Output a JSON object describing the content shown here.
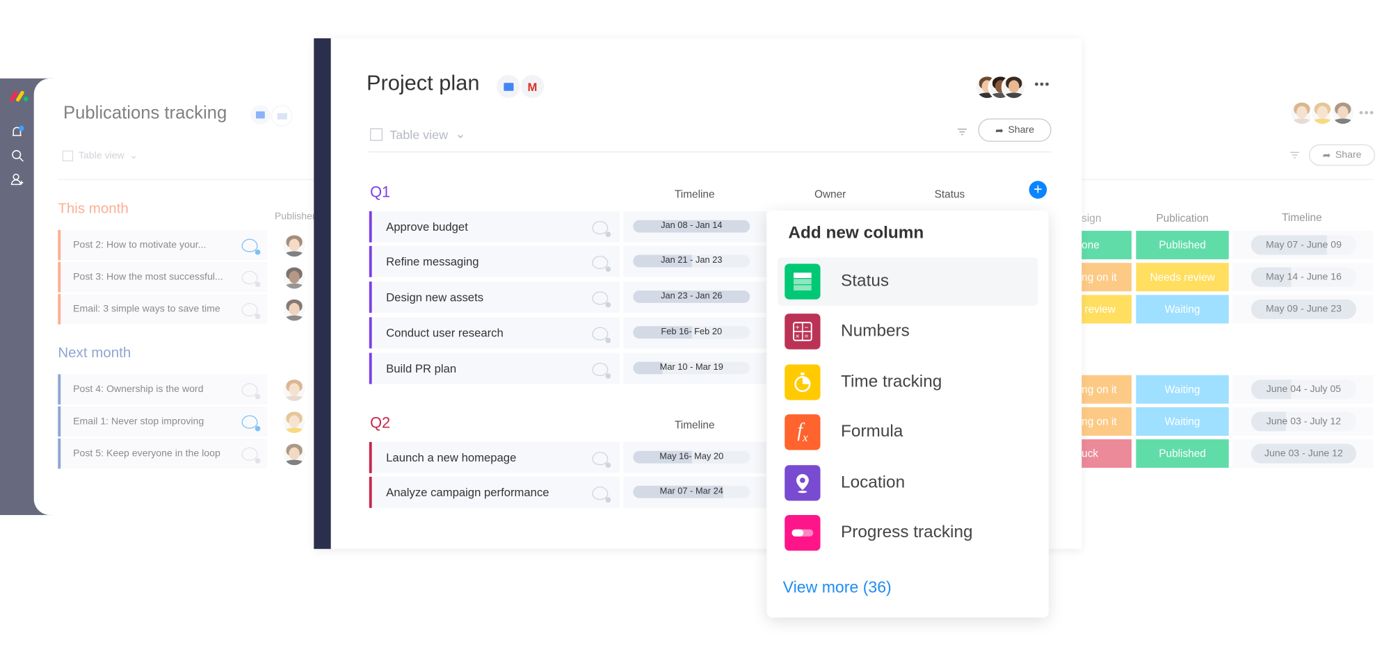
{
  "left_board": {
    "title": "Publications tracking",
    "view": "Table view",
    "publisher_header": "Publisher",
    "groups": [
      {
        "name": "This month",
        "color": "#fb7d4f",
        "items": [
          {
            "name": "Post 2: How to motivate your...",
            "comment_active": true
          },
          {
            "name": "Post 3: How the most successful...",
            "comment_active": false
          },
          {
            "name": "Email: 3 simple ways to save time",
            "comment_active": false
          }
        ]
      },
      {
        "name": "Next month",
        "color": "#4a6fb5",
        "items": [
          {
            "name": "Post 4: Ownership is the word",
            "comment_active": false
          },
          {
            "name": "Email 1: Never stop improving",
            "comment_active": true
          },
          {
            "name": "Post 5: Keep everyone in the loop",
            "comment_active": false
          }
        ]
      }
    ]
  },
  "center_board": {
    "title": "Project plan",
    "view": "Table view",
    "share_label": "Share",
    "columns": {
      "timeline": "Timeline",
      "owner": "Owner",
      "status": "Status"
    },
    "groups": [
      {
        "name": "Q1",
        "color": "#7b3fe4",
        "items": [
          {
            "name": "Approve budget",
            "timeline": "Jan 08 - Jan 14",
            "progress": 1.0
          },
          {
            "name": "Refine messaging",
            "timeline": "Jan 21 - Jan 23",
            "progress": 0.5
          },
          {
            "name": "Design new assets",
            "timeline": "Jan 23 - Jan 26",
            "progress": 1.0
          },
          {
            "name": "Conduct user research",
            "timeline": "Feb 16- Feb 20",
            "progress": 0.5
          },
          {
            "name": "Build PR plan",
            "timeline": "Mar 10 - Mar 19",
            "progress": 0.25
          }
        ]
      },
      {
        "name": "Q2",
        "color": "#c8254a",
        "items": [
          {
            "name": "Launch a new homepage",
            "timeline": "May 16- May 20",
            "progress": 0.5
          },
          {
            "name": "Analyze campaign performance",
            "timeline": "Mar 07 - Mar 24",
            "progress": 0.77
          }
        ]
      }
    ]
  },
  "add_column_menu": {
    "title": "Add new column",
    "items": [
      {
        "label": "Status",
        "color": "#00c875",
        "icon": "status-icon"
      },
      {
        "label": "Numbers",
        "color": "#bb3354",
        "icon": "numbers-icon"
      },
      {
        "label": "Time tracking",
        "color": "#ffcb00",
        "icon": "stopwatch-icon"
      },
      {
        "label": "Formula",
        "color": "#ff642e",
        "icon": "formula-icon"
      },
      {
        "label": "Location",
        "color": "#784bd1",
        "icon": "location-pin-icon"
      },
      {
        "label": "Progress tracking",
        "color": "#ff158a",
        "icon": "progress-icon"
      }
    ],
    "view_more": "View more (36)"
  },
  "right_board": {
    "share_label": "Share",
    "columns": {
      "design": "sign",
      "publication": "Publication",
      "timeline": "Timeline"
    },
    "rows": [
      {
        "design": "one",
        "design_color": "#00c875",
        "publication": "Published",
        "pub_color": "#00c875",
        "timeline": "May 07 - June 09",
        "progress": 0.72
      },
      {
        "design": "ng on it",
        "design_color": "#fdab3d",
        "publication": "Needs review",
        "pub_color": "#ffcb00",
        "timeline": "May 14 - June 16",
        "progress": 0.38
      },
      {
        "design": " review",
        "design_color": "#ffcb00",
        "publication": "Waiting",
        "pub_color": "#66ccff",
        "timeline": "May 09 - June 23",
        "progress": 1.0
      },
      {
        "design": "ng on it",
        "design_color": "#fdab3d",
        "publication": "Waiting",
        "pub_color": "#66ccff",
        "timeline": "June 04 - July 05",
        "progress": 0.38
      },
      {
        "design": "ng on it",
        "design_color": "#fdab3d",
        "publication": "Waiting",
        "pub_color": "#66ccff",
        "timeline": "June 03 - July 12",
        "progress": 0.33
      },
      {
        "design": "uck",
        "design_color": "#e2445c",
        "publication": "Published",
        "pub_color": "#00c875",
        "timeline": "June 03 - June 12",
        "progress": 1.0
      }
    ]
  }
}
